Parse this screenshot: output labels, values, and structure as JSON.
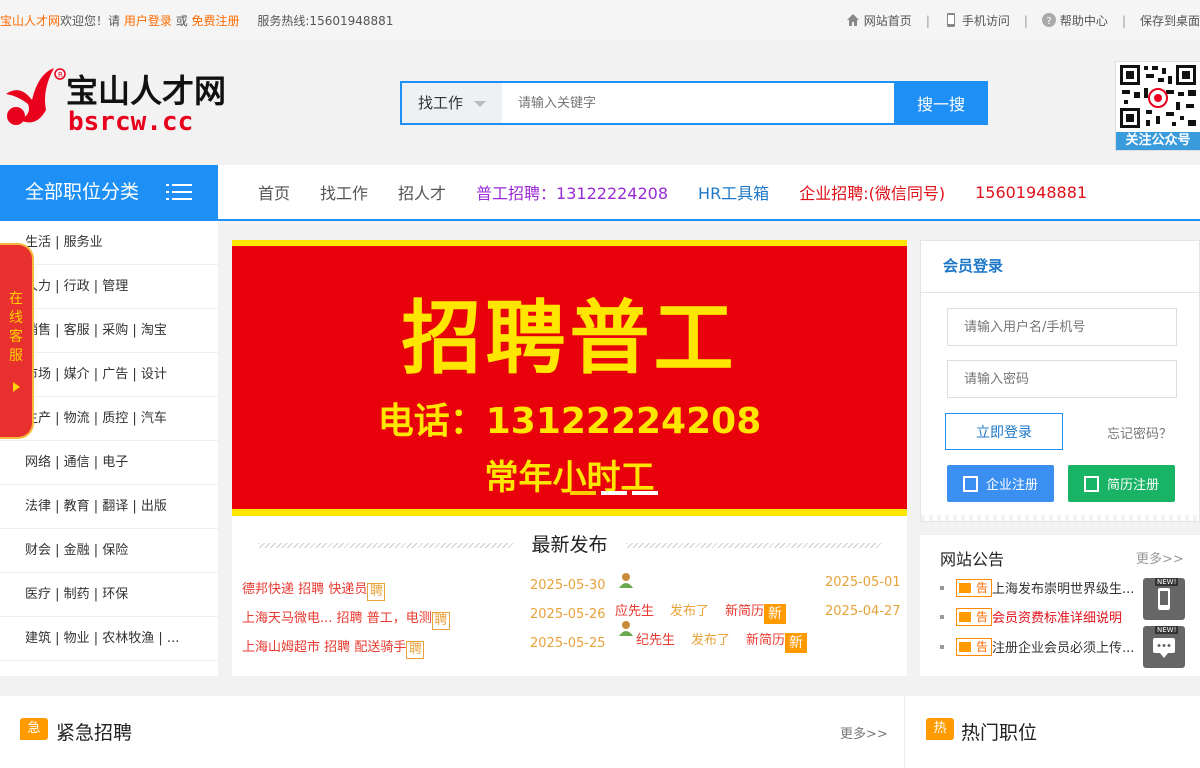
{
  "topbar": {
    "site_name": "宝山人才网",
    "welcome": "欢迎您！请",
    "login_link": "用户登录",
    "or": "或",
    "register_link": "免费注册",
    "hotline": "服务热线:15601948881",
    "links": [
      "网站首页",
      "手机访问",
      "帮助中心",
      "保存到桌面"
    ]
  },
  "header": {
    "logo_cn": "宝山人才网",
    "logo_en": "bsrcw.cc",
    "search_type": "找工作",
    "search_placeholder": "请输入关键字",
    "search_button": "搜一搜",
    "qr_label": "关注公众号"
  },
  "nav": {
    "category_title": "全部职位分类",
    "items": [
      {
        "label": "首页",
        "color": "#555555",
        "new": false
      },
      {
        "label": "找工作",
        "color": "#555555",
        "new": true
      },
      {
        "label": "招人才",
        "color": "#555555",
        "new": true
      },
      {
        "label": "普工招聘：13122224208",
        "color": "#9a2bd6",
        "new": false
      },
      {
        "label": "HR工具箱",
        "color": "#1e78c8",
        "new": false
      },
      {
        "label": "企业招聘:(微信同号)",
        "color": "#e0101a",
        "new": false
      },
      {
        "label": "15601948881",
        "color": "#e0101a",
        "new": false
      }
    ],
    "new_tag": "NEW"
  },
  "categories": [
    "生活 | 服务业",
    "人力 | 行政 | 管理",
    "销售 | 客服 | 采购 | 淘宝",
    "市场 | 媒介 | 广告 | 设计",
    "生产 | 物流 | 质控 | 汽车",
    "网络 | 通信 | 电子",
    "法律 | 教育 | 翻译 | 出版",
    "财会 | 金融 | 保险",
    "医疗 | 制药 | 环保",
    "建筑 | 物业 | 农林牧渔 | ..."
  ],
  "online_service": "在线客服",
  "banner": {
    "line1": "招聘普工",
    "line2": "电话：13122224208",
    "line3": "常年小时工"
  },
  "latest": {
    "title": "最新发布",
    "jobs": [
      {
        "company": "德邦快递",
        "action": "招聘",
        "job": "快递员",
        "tag": "聘",
        "date": "2025-05-30"
      },
      {
        "company": "上海天马微电...",
        "action": "招聘",
        "job": "普工，电测",
        "tag": "聘",
        "date": "2025-05-26"
      },
      {
        "company": "上海山姆超市",
        "action": "招聘",
        "job": "配送骑手",
        "tag": "聘",
        "date": "2025-05-25"
      }
    ],
    "resumes": [
      {
        "name": "应先生",
        "action": "发布了",
        "item": "新简历",
        "tag": "新",
        "date": "2025-05-01"
      },
      {
        "name": "纪先生",
        "action": "发布了",
        "item": "新简历",
        "tag": "新",
        "date": "2025-04-27"
      }
    ]
  },
  "login": {
    "title": "会员登录",
    "user_placeholder": "请输入用户名/手机号",
    "pass_placeholder": "请输入密码",
    "login_button": "立即登录",
    "forgot": "忘记密码？",
    "company_register": "企业注册",
    "resume_register": "简历注册"
  },
  "notice": {
    "title": "网站公告",
    "more": "更多>>",
    "tag": "告",
    "items": [
      {
        "text": "上海发布崇明世界级生...",
        "color": "#333333"
      },
      {
        "text": "会员资费标准详细说明",
        "color": "#e0101a"
      },
      {
        "text": "注册企业会员必须上传...",
        "color": "#333333"
      }
    ]
  },
  "float_tools": {
    "new_label": "NEW!"
  },
  "bottom": {
    "urgent_badge": "急",
    "urgent_title": "紧急招聘",
    "urgent_more": "更多>>",
    "hot_badge": "热",
    "hot_title": "热门职位"
  }
}
